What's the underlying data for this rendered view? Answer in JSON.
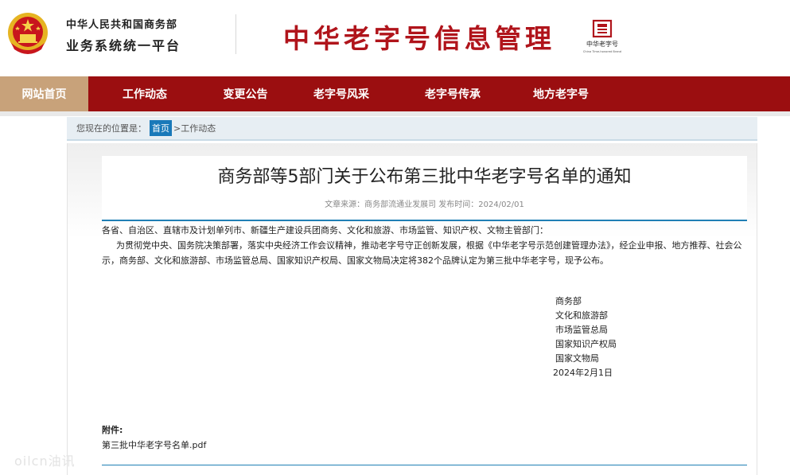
{
  "header": {
    "org_line1": "中华人民共和国商务部",
    "org_line2": "业务系统统一平台",
    "site_title": "中华老字号信息管理",
    "brand_mark_name": "中华老字号",
    "brand_mark_en": "China Time-honored Brand",
    "colors": {
      "brand_red": "#b0141b",
      "emblem_gold": "#e6b422"
    }
  },
  "nav": {
    "items": [
      {
        "label": "网站首页",
        "active": true
      },
      {
        "label": "工作动态",
        "active": false
      },
      {
        "label": "变更公告",
        "active": false
      },
      {
        "label": "老字号风采",
        "active": false
      },
      {
        "label": "老字号传承",
        "active": false
      },
      {
        "label": "地方老字号",
        "active": false
      }
    ],
    "colors": {
      "bar": "#9b0e10",
      "active": "#c8a27a"
    }
  },
  "breadcrumb": {
    "prefix": "您现在的位置是：",
    "home": "首页",
    "current": ">工作动态"
  },
  "article": {
    "title": "商务部等5部门关于公布第三批中华老字号名单的通知",
    "meta": "文章来源：商务部流通业发展司 发布时间：2024/02/01",
    "salutation": "各省、自治区、直辖市及计划单列市、新疆生产建设兵团商务、文化和旅游、市场监管、知识产权、文物主管部门：",
    "paragraph": "为贯彻党中央、国务院决策部署，落实中央经济工作会议精神，推动老字号守正创新发展，根据《中华老字号示范创建管理办法》，经企业申报、地方推荐、社会公示，商务部、文化和旅游部、市场监管总局、国家知识产权局、国家文物局决定将382个品牌认定为第三批中华老字号，现予公布。",
    "signers": [
      "商务部",
      "文化和旅游部",
      "市场监管总局",
      "国家知识产权局",
      "国家文物局"
    ],
    "date": "2024年2月1日",
    "attachment_label": "附件:",
    "attachment_file": "第三批中华老字号名单.pdf"
  },
  "watermark": "oilcn油讯"
}
